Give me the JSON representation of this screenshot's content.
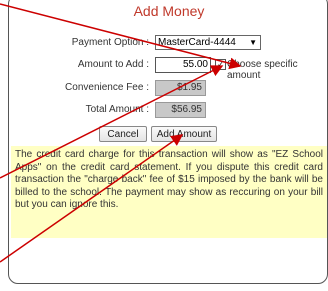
{
  "dialog": {
    "title": "Add Money",
    "payment_option_label": "Payment Option :",
    "payment_option_value": "MasterCard-4444",
    "amount_label": "Amount to Add :",
    "amount_value": "55.00",
    "choose_specific_label": "Choose specific amount",
    "fee_label": "Convenience Fee :",
    "fee_value": "$1.95",
    "total_label": "Total Amount :",
    "total_value": "$56.95",
    "cancel_label": "Cancel",
    "add_amount_label": "Add Amount",
    "note": "The credit card charge for this transaction will show as \"EZ School Apps\" on the credit card statement. If you dispute this credit card transaction the \"charge back\" fee of $15 imposed by the bank will be billed to the school. The payment may show as reccuring on your bill but you can ignore this."
  },
  "colors": {
    "title": "#c0392b",
    "arrow": "#cc0000",
    "note_bg": "#ffffc4"
  },
  "icons": [
    "chevron-down-icon",
    "checkbox-icon",
    "arrow-annotation"
  ]
}
